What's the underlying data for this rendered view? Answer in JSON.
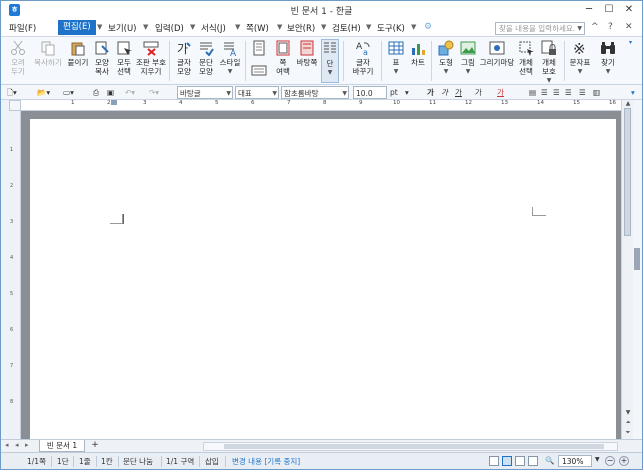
{
  "window": {
    "title": "빈 문서 1 - 한글",
    "minimize": "─",
    "maximize": "☐",
    "close": "✕"
  },
  "menubar": {
    "items": [
      {
        "label": "파일(F)",
        "active": false
      },
      {
        "label": "편집(E)",
        "active": true
      },
      {
        "label": "보기(U)",
        "active": false
      },
      {
        "label": "입력(D)",
        "active": false
      },
      {
        "label": "서식(J)",
        "active": false
      },
      {
        "label": "쪽(W)",
        "active": false
      },
      {
        "label": "보안(R)",
        "active": false
      },
      {
        "label": "검토(H)",
        "active": false
      },
      {
        "label": "도구(K)",
        "active": false
      }
    ],
    "help_placeholder": "찾을 내용을 입력하세요.",
    "up_icon": "^",
    "help_icon": "?",
    "close_doc": "✕"
  },
  "ribbon": {
    "buttons": [
      {
        "id": "cut",
        "label": "오려\n두기",
        "disabled": true,
        "icon": "scissors-icon"
      },
      {
        "id": "copy",
        "label": "복사하기",
        "disabled": true,
        "icon": "copy-icon"
      },
      {
        "id": "paste",
        "label": "붙이기",
        "disabled": false,
        "icon": "paste-icon"
      },
      {
        "id": "format_copy",
        "label": "모양\n복사",
        "disabled": false,
        "icon": "format-painter-icon"
      },
      {
        "id": "select_all",
        "label": "모두\n선택",
        "disabled": false,
        "icon": "select-all-icon"
      },
      {
        "id": "clear_protect",
        "label": "조판 부호\n지우기",
        "disabled": false,
        "icon": "clear-codes-icon"
      },
      {
        "id": "char_shape",
        "label": "글자\n모양",
        "disabled": false,
        "icon": "char-shape-icon"
      },
      {
        "id": "para_shape",
        "label": "문단\n모양",
        "disabled": false,
        "icon": "para-shape-icon"
      },
      {
        "id": "style",
        "label": "스타일",
        "disabled": false,
        "icon": "style-icon"
      },
      {
        "id": "page_margin",
        "label": "쪽\n여백",
        "disabled": false,
        "icon": "page-margin-icon"
      },
      {
        "id": "background",
        "label": "바탕쪽",
        "disabled": false,
        "icon": "background-page-icon"
      },
      {
        "id": "column",
        "label": "단",
        "disabled": false,
        "icon": "column-icon"
      },
      {
        "id": "replace_char",
        "label": "글자\n바꾸기",
        "disabled": false,
        "icon": "replace-char-icon"
      },
      {
        "id": "table",
        "label": "표",
        "disabled": false,
        "icon": "table-icon"
      },
      {
        "id": "chart",
        "label": "차트",
        "disabled": false,
        "icon": "chart-icon"
      },
      {
        "id": "shape",
        "label": "도형",
        "disabled": false,
        "icon": "shape-icon"
      },
      {
        "id": "picture",
        "label": "그림",
        "disabled": false,
        "icon": "picture-icon"
      },
      {
        "id": "draw_grimagi",
        "label": "그리기마당",
        "disabled": false,
        "icon": "drawing-gallery-icon"
      },
      {
        "id": "object_select",
        "label": "개체\n선택",
        "disabled": false,
        "icon": "object-select-icon"
      },
      {
        "id": "object_protect",
        "label": "개체\n보호",
        "disabled": false,
        "icon": "object-protect-icon"
      },
      {
        "id": "symbol",
        "label": "문자표",
        "disabled": false,
        "icon": "symbol-icon"
      },
      {
        "id": "find",
        "label": "찾기",
        "disabled": false,
        "icon": "binoculars-icon"
      }
    ]
  },
  "formatbar": {
    "style": "바탕글",
    "font_lang": "대표",
    "font": "함초롬바탕",
    "size": "10.0",
    "unit": "pt",
    "bold": "가",
    "italic": "가",
    "underline": "가",
    "strike": "가",
    "font_color": "가"
  },
  "ruler": {
    "numbers": [
      "1",
      "2",
      "3",
      "4",
      "5",
      "6",
      "7",
      "8",
      "9",
      "10",
      "11",
      "12",
      "13",
      "14",
      "15",
      "16"
    ],
    "v_numbers": [
      "1",
      "2",
      "3",
      "4",
      "5",
      "6",
      "7",
      "8"
    ]
  },
  "tabs": {
    "doc_tab": "빈 문서 1",
    "add_tab": "+"
  },
  "status": {
    "page": "1/1쪽",
    "column": "1단",
    "line": "1줄",
    "char": "1칸",
    "para": "문단 나눔",
    "section": "1/1 구역",
    "insert": "삽입",
    "track": "변경 내용 [기록 중지]",
    "zoom": "130%"
  },
  "colors": {
    "accent": "#1e73c9",
    "frame": "#6e9ac8",
    "doc_bg": "#8a8f96"
  }
}
